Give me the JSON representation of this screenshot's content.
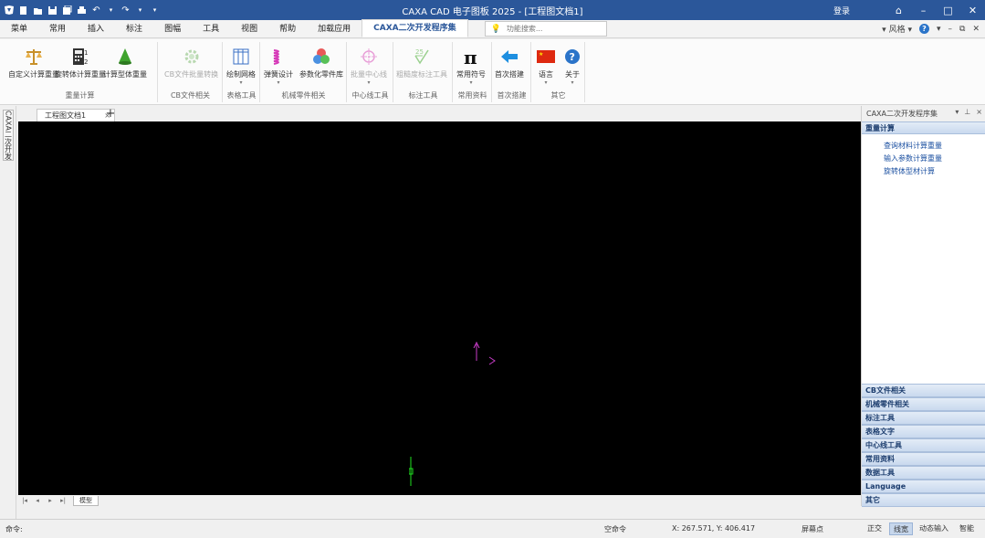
{
  "titlebar": {
    "title": "CAXA CAD 电子图板 2025 - [工程图文档1]",
    "user": "登录",
    "quick_access": [
      "new-file-icon",
      "open-folder-icon",
      "save-icon",
      "save-all-icon",
      "print-icon",
      "undo-icon",
      "redo-icon",
      "customize-icon"
    ]
  },
  "menu": {
    "tabs": [
      "常用",
      "插入",
      "标注",
      "图幅",
      "工具",
      "视图",
      "帮助",
      "加载应用",
      "CAXA二次开发程序集"
    ],
    "first_tab": "菜单",
    "active_index": 8,
    "search_placeholder": "功能搜索...",
    "style_label": "风格",
    "help_label": "?"
  },
  "ribbon": {
    "groups": [
      {
        "label": "重量计算",
        "buttons": [
          "自定义计算重量",
          "旋转体计算重量",
          "计算型体重量"
        ]
      },
      {
        "label": "CB文件相关",
        "buttons": [
          "CB文件批量转换"
        ]
      },
      {
        "label": "表格工具",
        "buttons": [
          "绘制网格"
        ]
      },
      {
        "label": "机械零件相关",
        "buttons": [
          "弹簧设计",
          "参数化零件库"
        ]
      },
      {
        "label": "中心线工具",
        "buttons": [
          "批量中心线"
        ]
      },
      {
        "label": "标注工具",
        "buttons": [
          "粗糙度标注工具"
        ]
      },
      {
        "label": "常用资料",
        "buttons": [
          "常用符号"
        ]
      },
      {
        "label": "首次搭建",
        "buttons": [
          "首次搭建"
        ]
      },
      {
        "label": "其它",
        "buttons": [
          "语言",
          "关于"
        ]
      }
    ]
  },
  "left_strip": {
    "tab_label": "CAXA二次开发"
  },
  "document": {
    "tab_label": "工程图文档1",
    "close": "×",
    "add": "+"
  },
  "sheetbar": {
    "sheet_label": "模型",
    "nav": [
      "|◂",
      "◂",
      "▸",
      "▸|"
    ]
  },
  "right_panel": {
    "title": "CAXA二次开发程序集",
    "controls": [
      "▾",
      "×"
    ],
    "expanded_section": "重量计算",
    "items": [
      "查询材料计算重量",
      "输入参数计算重量",
      "旋转体型材计算"
    ],
    "collapsed_sections": [
      "CB文件相关",
      "机械零件相关",
      "标注工具",
      "表格文字",
      "中心线工具",
      "常用资料",
      "数据工具",
      "Language",
      "其它"
    ]
  },
  "statusbar": {
    "command": "命令:",
    "prompt": "空命令",
    "coords": "X: 267.571, Y: 406.417",
    "snap": "屏幕点",
    "toggles": [
      "正交",
      "线宽",
      "动态输入",
      "智能"
    ]
  },
  "colors": {
    "accent": "#2b579a",
    "canvas": "#000000",
    "ucs": "#c83cc8",
    "cursor": "#1fe01f"
  }
}
